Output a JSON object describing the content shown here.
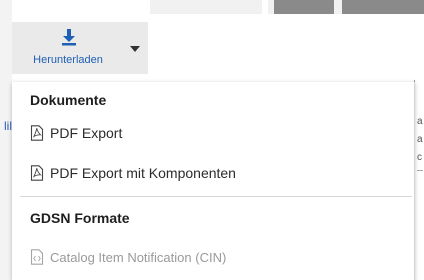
{
  "download": {
    "label": "Herunterladen"
  },
  "background": {
    "left_link_fragment": "lil",
    "right_fragments": [
      "a",
      "a",
      "c"
    ]
  },
  "menu": {
    "section_documents": "Dokumente",
    "pdf_export": "PDF Export",
    "pdf_export_components": "PDF Export mit Komponenten",
    "section_gdsn": "GDSN Formate",
    "cin": "Catalog Item Notification (CIN)"
  },
  "colors": {
    "accent_blue": "#1f5fb5",
    "disabled_text": "#9a9a9a"
  }
}
